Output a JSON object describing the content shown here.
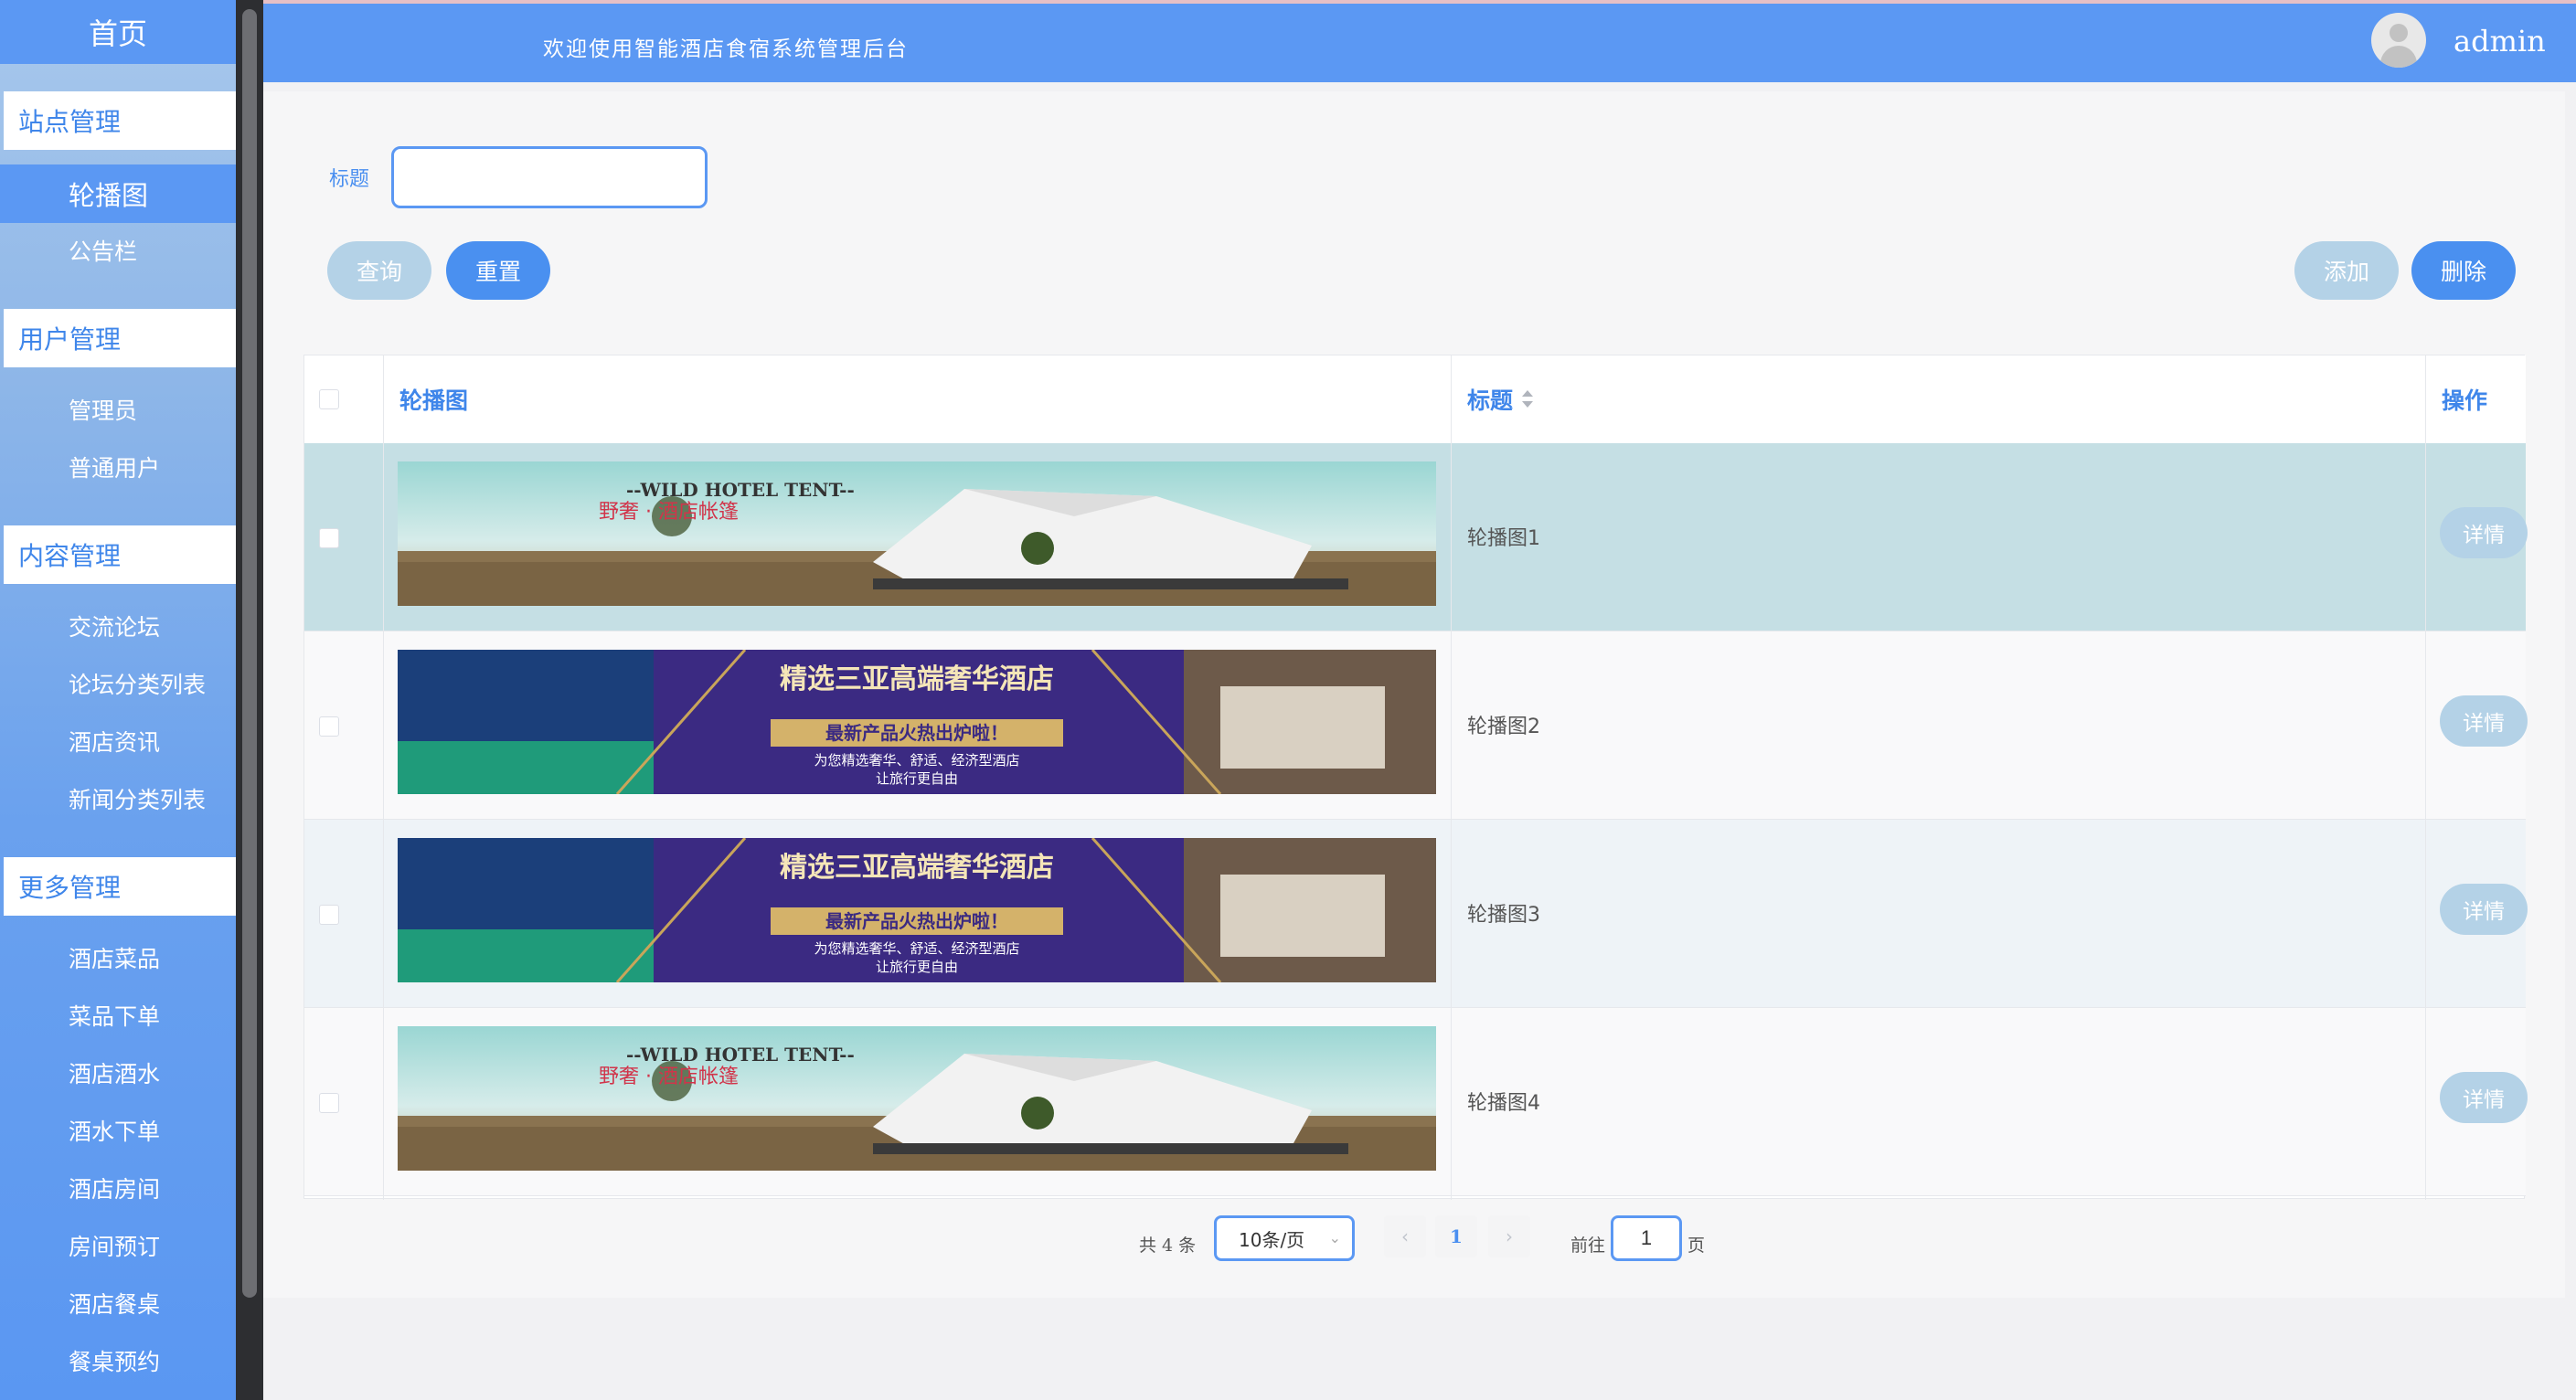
{
  "sidebar": {
    "home": "首页",
    "groups": [
      {
        "label": "站点管理",
        "items": [
          "轮播图",
          "公告栏"
        ]
      },
      {
        "label": "用户管理",
        "items": [
          "管理员",
          "普通用户"
        ]
      },
      {
        "label": "内容管理",
        "items": [
          "交流论坛",
          "论坛分类列表",
          "酒店资讯",
          "新闻分类列表"
        ]
      },
      {
        "label": "更多管理",
        "items": [
          "酒店菜品",
          "菜品下单",
          "酒店酒水",
          "酒水下单",
          "酒店房间",
          "房间预订",
          "酒店餐桌",
          "餐桌预约"
        ]
      }
    ],
    "active_item": "轮播图"
  },
  "header": {
    "title": "欢迎使用智能酒店食宿系统管理后台",
    "user": "admin"
  },
  "search": {
    "label": "标题",
    "value": "",
    "query_label": "查询",
    "reset_label": "重置",
    "add_label": "添加",
    "delete_label": "删除"
  },
  "table": {
    "columns": [
      "轮播图",
      "标题",
      "操作"
    ],
    "rows": [
      {
        "title": "轮播图1",
        "banner": {
          "line1": "--WILD HOTEL TENT--",
          "line2": "野奢 · 酒店帐篷"
        },
        "action": "详情"
      },
      {
        "title": "轮播图2",
        "banner": {
          "line1": "精选三亚高端奢华酒店",
          "line2": "最新产品火热出炉啦！",
          "line3": "为您精选奢华、舒适、经济型酒店",
          "line4": "让旅行更自由"
        },
        "action": "详情"
      },
      {
        "title": "轮播图3",
        "banner": {
          "line1": "精选三亚高端奢华酒店",
          "line2": "最新产品火热出炉啦！",
          "line3": "为您精选奢华、舒适、经济型酒店",
          "line4": "让旅行更自由"
        },
        "action": "详情"
      },
      {
        "title": "轮播图4",
        "banner": {
          "line1": "--WILD HOTEL TENT--",
          "line2": "野奢 · 酒店帐篷"
        },
        "action": "详情"
      }
    ]
  },
  "pagination": {
    "total": "共 4 条",
    "page_size": "10条/页",
    "current_page": "1",
    "goto_label": "前往",
    "goto_value": "1",
    "goto_suffix": "页"
  },
  "colors": {
    "primary": "#5b98f3",
    "light_button": "#b4d2e7",
    "selected_row": "#c5dfe4"
  }
}
